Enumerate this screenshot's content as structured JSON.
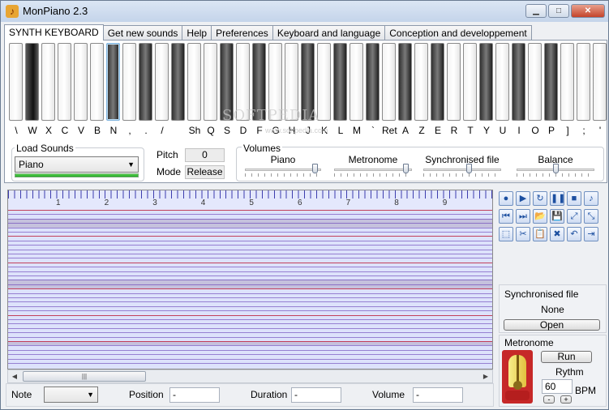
{
  "window": {
    "title": "MonPiano 2.3",
    "minimize_glyph": "▁",
    "maximize_glyph": "□",
    "close_glyph": "✕"
  },
  "tabs": [
    {
      "label": "SYNTH KEYBOARD",
      "active": true
    },
    {
      "label": "Get new sounds",
      "active": false
    },
    {
      "label": "Help",
      "active": false
    },
    {
      "label": "Preferences",
      "active": false
    },
    {
      "label": "Keyboard and language",
      "active": false
    },
    {
      "label": "Conception and developpement",
      "active": false
    }
  ],
  "keyboard": {
    "keys": [
      {
        "label": "\\",
        "black": false
      },
      {
        "label": "W",
        "black": true
      },
      {
        "label": "X",
        "black": false
      },
      {
        "label": "C",
        "black": false
      },
      {
        "label": "V",
        "black": false
      },
      {
        "label": "B",
        "black": false
      },
      {
        "label": "N",
        "black": true,
        "pressed": true
      },
      {
        "label": ",",
        "black": false
      },
      {
        "label": ".",
        "black": true
      },
      {
        "label": "/",
        "black": false
      },
      {
        "label": "",
        "black": true
      },
      {
        "label": "Sh",
        "black": false
      },
      {
        "label": "Q",
        "black": false
      },
      {
        "label": "S",
        "black": true
      },
      {
        "label": "D",
        "black": false
      },
      {
        "label": "F",
        "black": true
      },
      {
        "label": "G",
        "black": false
      },
      {
        "label": "H",
        "black": false
      },
      {
        "label": "J",
        "black": true
      },
      {
        "label": "K",
        "black": false
      },
      {
        "label": "L",
        "black": true
      },
      {
        "label": "M",
        "black": false
      },
      {
        "label": "`",
        "black": true
      },
      {
        "label": "Ret",
        "black": false
      },
      {
        "label": "A",
        "black": true
      },
      {
        "label": "Z",
        "black": false
      },
      {
        "label": "E",
        "black": true
      },
      {
        "label": "R",
        "black": false
      },
      {
        "label": "T",
        "black": false
      },
      {
        "label": "Y",
        "black": true
      },
      {
        "label": "U",
        "black": false
      },
      {
        "label": "I",
        "black": true
      },
      {
        "label": "O",
        "black": false
      },
      {
        "label": "P",
        "black": true
      },
      {
        "label": "]",
        "black": false
      },
      {
        "label": ";",
        "black": false
      },
      {
        "label": "'",
        "black": false
      }
    ],
    "watermark": "SOFTPEDIA",
    "watermark_sub": "www.softpedia.com"
  },
  "load_sounds": {
    "label": "Load Sounds",
    "selected": "Piano"
  },
  "pitch": {
    "label": "Pitch",
    "value": "0"
  },
  "mode": {
    "label": "Mode",
    "value": "Release"
  },
  "volumes": {
    "label": "Volumes",
    "sliders": [
      {
        "label": "Piano",
        "level": 0.95
      },
      {
        "label": "Metronome",
        "level": 0.95
      },
      {
        "label": "Synchronised file",
        "level": 0.6
      },
      {
        "label": "Balance",
        "level": 0.5
      }
    ]
  },
  "roll": {
    "measures": [
      "1",
      "2",
      "3",
      "4",
      "5",
      "6",
      "7",
      "8",
      "9"
    ],
    "scroll_grip": "|||"
  },
  "toolbar": {
    "buttons": [
      {
        "name": "record-icon",
        "glyph": "●"
      },
      {
        "name": "play-icon",
        "glyph": "▶"
      },
      {
        "name": "loop-icon",
        "glyph": "↻"
      },
      {
        "name": "pause-icon",
        "glyph": "❚❚"
      },
      {
        "name": "stop-icon",
        "glyph": "■"
      },
      {
        "name": "export-icon",
        "glyph": "♪"
      },
      {
        "name": "rewind-icon",
        "glyph": "⏮"
      },
      {
        "name": "forward-icon",
        "glyph": "⏭"
      },
      {
        "name": "open-folder-icon",
        "glyph": "📂"
      },
      {
        "name": "save-icon",
        "glyph": "💾"
      },
      {
        "name": "zoom-in-icon",
        "glyph": "⤢"
      },
      {
        "name": "zoom-out-icon",
        "glyph": "⤡"
      },
      {
        "name": "select-icon",
        "glyph": "⬚"
      },
      {
        "name": "cut-icon",
        "glyph": "✂"
      },
      {
        "name": "paste-icon",
        "glyph": "📋"
      },
      {
        "name": "delete-icon",
        "glyph": "✖"
      },
      {
        "name": "undo-icon",
        "glyph": "↶"
      },
      {
        "name": "end-icon",
        "glyph": "⇥"
      }
    ]
  },
  "synchronised_file": {
    "label": "Synchronised file",
    "value": "None",
    "open_label": "Open"
  },
  "metronome": {
    "label": "Metronome",
    "run_label": "Run",
    "rythm_label": "Rythm",
    "bpm_value": "60",
    "bpm_unit": "BPM",
    "minus": "-",
    "plus": "+"
  },
  "note_info": {
    "note_label": "Note",
    "position_label": "Position",
    "position_value": "-",
    "duration_label": "Duration",
    "duration_value": "-",
    "volume_label": "Volume",
    "volume_value": "-"
  },
  "colors": {
    "roll_bg": "#dde2fb",
    "line_red": "#c0304a",
    "line_purple": "#5b2fb0",
    "band_gray": "#b0a6c4"
  }
}
